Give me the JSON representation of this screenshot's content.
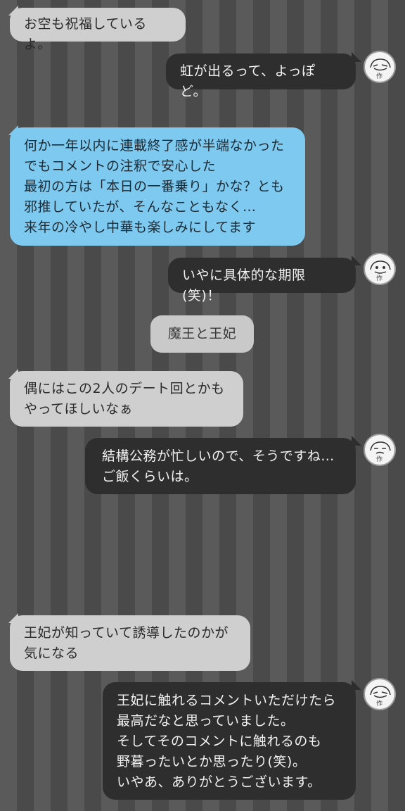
{
  "chat": {
    "messages": [
      {
        "side": "left",
        "style": "light",
        "text": "お空も祝福しているよ。"
      },
      {
        "side": "right",
        "style": "dark",
        "text": "虹が出るって、よっぽど。"
      },
      {
        "side": "left",
        "style": "blue",
        "text": "何か一年以内に連載終了感が半端なかった\nでもコメントの注釈で安心した\n最初の方は「本日の一番乗り」かな？とも\n邪推していたが、そんなこともなく…\n来年の冷やし中華も楽しみにしてます"
      },
      {
        "side": "right",
        "style": "dark",
        "text": "いやに具体的な期限(笑)！"
      },
      {
        "side": "center",
        "style": "label",
        "text": "魔王と王妃"
      },
      {
        "side": "left",
        "style": "light",
        "text": "偶にはこの2人のデート回とかも\nやってほしいなぁ"
      },
      {
        "side": "right",
        "style": "dark",
        "text": "結構公務が忙しいので、そうですね…\nご飯くらいは。"
      },
      {
        "side": "left",
        "style": "light",
        "text": "王妃が知っていて誘導したのかが\n気になる"
      },
      {
        "side": "right",
        "style": "dark",
        "text": "王妃に触れるコメントいただけたら\n最高だなと思っていました。\nそしてそのコメントに触れるのも\n野暮ったいとか思ったり(笑)。\nいやあ、ありがとうございます。"
      }
    ],
    "avatar_label": "作",
    "colors": {
      "stripe_light": "#5a5a5a",
      "stripe_dark": "#4a4a4a",
      "bubble_light": "#cfcfcf",
      "bubble_blue": "#7ec9ef",
      "bubble_dark": "#2e2e2e"
    }
  }
}
